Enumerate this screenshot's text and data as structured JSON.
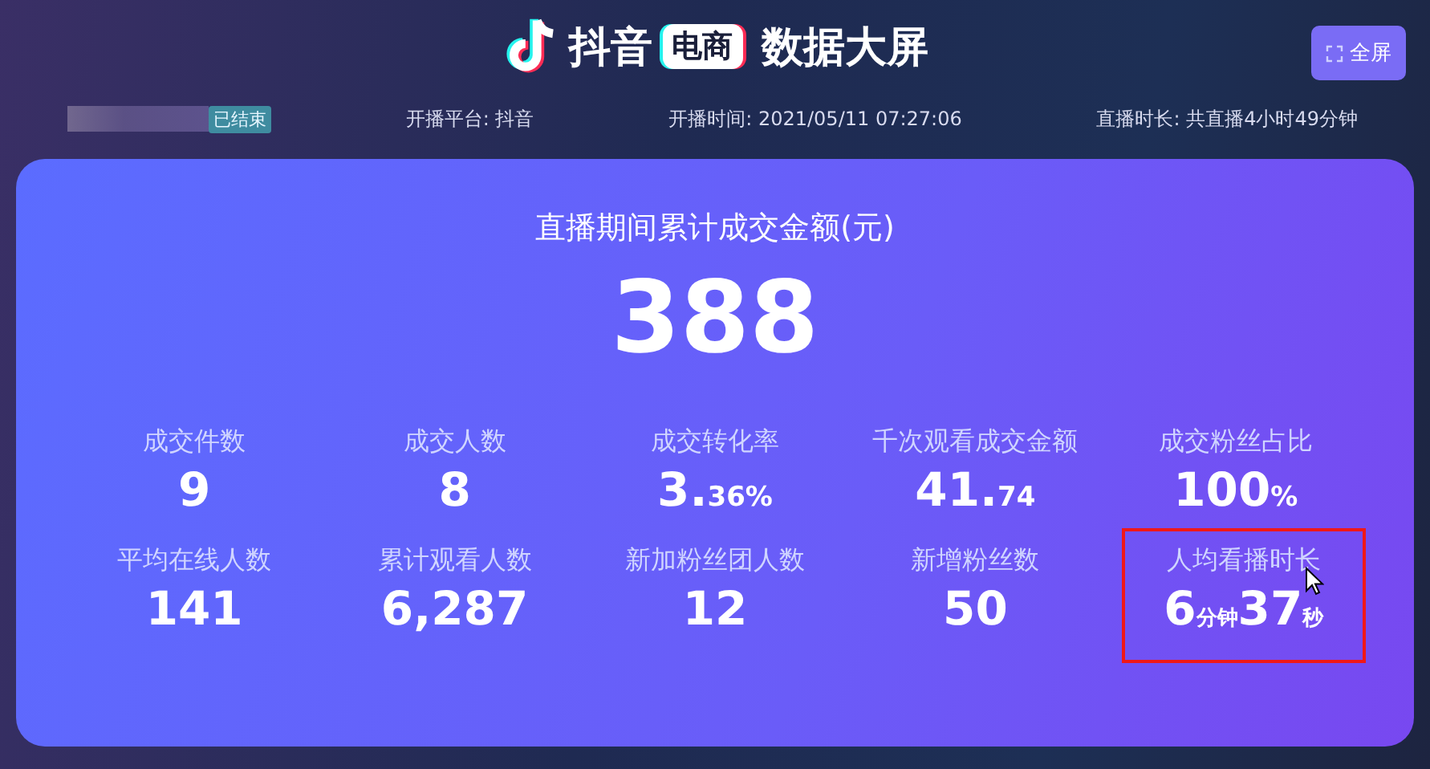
{
  "header": {
    "brand": "抖音",
    "brand_badge": "电商",
    "title": "数据大屏",
    "fullscreen_button": "全屏"
  },
  "info_bar": {
    "status": "已结束",
    "platform": "开播平台: 抖音",
    "start_time": "开播时间: 2021/05/11 07:27:06",
    "duration": "直播时长: 共直播4小时49分钟"
  },
  "summary": {
    "label": "直播期间累计成交金额(元)",
    "value": "388"
  },
  "metrics": [
    {
      "label": "成交件数",
      "highlighted": false,
      "parts": [
        {
          "kind": "big",
          "text": "9"
        }
      ]
    },
    {
      "label": "成交人数",
      "highlighted": false,
      "parts": [
        {
          "kind": "big",
          "text": "8"
        }
      ]
    },
    {
      "label": "成交转化率",
      "highlighted": false,
      "parts": [
        {
          "kind": "big",
          "text": "3."
        },
        {
          "kind": "small",
          "text": "36%"
        }
      ]
    },
    {
      "label": "千次观看成交金额",
      "highlighted": false,
      "parts": [
        {
          "kind": "big",
          "text": "41."
        },
        {
          "kind": "small",
          "text": "74"
        }
      ]
    },
    {
      "label": "成交粉丝占比",
      "highlighted": false,
      "parts": [
        {
          "kind": "big",
          "text": "100"
        },
        {
          "kind": "small",
          "text": "%"
        }
      ]
    },
    {
      "label": "平均在线人数",
      "highlighted": false,
      "parts": [
        {
          "kind": "big",
          "text": "141"
        }
      ]
    },
    {
      "label": "累计观看人数",
      "highlighted": false,
      "parts": [
        {
          "kind": "big",
          "text": "6,287"
        }
      ]
    },
    {
      "label": "新加粉丝团人数",
      "highlighted": false,
      "parts": [
        {
          "kind": "big",
          "text": "12"
        }
      ]
    },
    {
      "label": "新增粉丝数",
      "highlighted": false,
      "parts": [
        {
          "kind": "big",
          "text": "50"
        }
      ]
    },
    {
      "label": "人均看播时长",
      "highlighted": true,
      "parts": [
        {
          "kind": "big",
          "text": "6"
        },
        {
          "kind": "tiny",
          "text": "分钟"
        },
        {
          "kind": "big",
          "text": "37"
        },
        {
          "kind": "tiny",
          "text": "秒"
        }
      ]
    }
  ]
}
